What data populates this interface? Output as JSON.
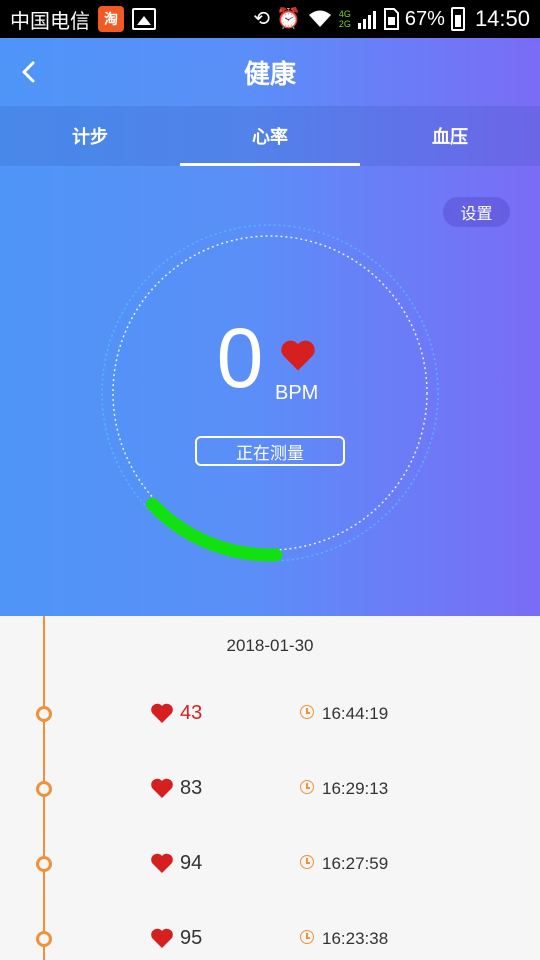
{
  "status_bar": {
    "carrier": "中国电信",
    "app_icon_label": "淘",
    "battery": "67%",
    "time": "14:50",
    "network_top": "4G",
    "network_bottom": "2G",
    "icons": [
      "taobao-icon",
      "gallery-icon",
      "screen-rotate-icon",
      "alarm-icon",
      "wifi-icon",
      "signal-icon",
      "sim-icon",
      "battery-icon"
    ]
  },
  "header": {
    "title": "健康",
    "back_icon": "chevron-left-icon"
  },
  "tabs": [
    {
      "label": "计步",
      "active": false
    },
    {
      "label": "心率",
      "active": true
    },
    {
      "label": "血压",
      "active": false
    }
  ],
  "monitor": {
    "settings_label": "设置",
    "bpm_value": "0",
    "bpm_unit": "BPM",
    "measure_label": "正在测量",
    "heart_icon": "heart-icon"
  },
  "history": {
    "date": "2018-01-30",
    "records": [
      {
        "bpm": "43",
        "time": "16:44:19",
        "alert": true
      },
      {
        "bpm": "83",
        "time": "16:29:13",
        "alert": false
      },
      {
        "bpm": "94",
        "time": "16:27:59",
        "alert": false
      },
      {
        "bpm": "95",
        "time": "16:23:38",
        "alert": false
      }
    ]
  },
  "colors": {
    "gradient_start": "#4f95f7",
    "gradient_end": "#7a6cf6",
    "progress_arc": "#11e011",
    "heart": "#d62020",
    "timeline": "#f0923a"
  }
}
